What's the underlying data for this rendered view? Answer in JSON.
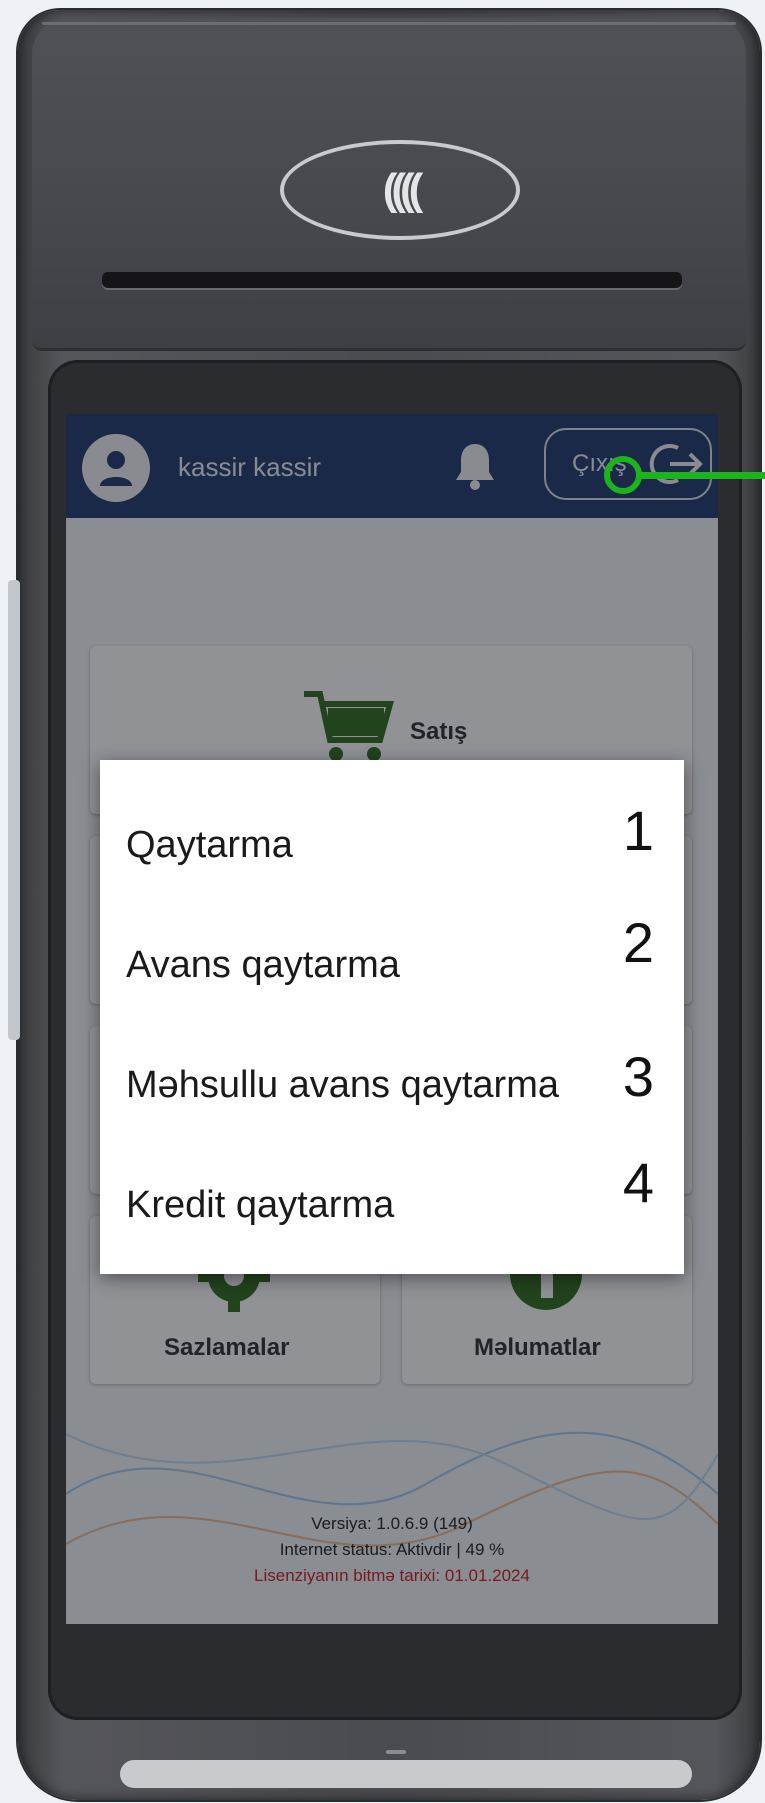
{
  "header": {
    "username": "kassir kassir",
    "exit_label": "Çıxış"
  },
  "tiles": {
    "sale": "Satış",
    "settings": "Sazlamalar",
    "info": "Məlumatlar"
  },
  "footer": {
    "version": "Versiya: 1.0.6.9 (149)",
    "internet_status": "Internet status: Aktivdir | 49 %",
    "license_expiry": "Lisenziyanın bitmə tarixi: 01.01.2024"
  },
  "popup": {
    "items": [
      {
        "label": "Qaytarma",
        "number": "1"
      },
      {
        "label": "Avans qaytarma",
        "number": "2"
      },
      {
        "label": "Məhsullu avans qaytarma",
        "number": "3"
      },
      {
        "label": "Kredit qaytarma",
        "number": "4"
      }
    ]
  },
  "colors": {
    "header_bg": "#1f3a6b",
    "icon_green": "#2f6b1e",
    "annotation_green": "#1db31d",
    "license_red": "#c81e1e"
  },
  "icons": {
    "avatar": "user-avatar-icon",
    "notification": "bell-icon",
    "exit": "logout-icon",
    "sale": "shopping-cart-icon",
    "settings": "gear-icon",
    "info": "info-icon"
  }
}
